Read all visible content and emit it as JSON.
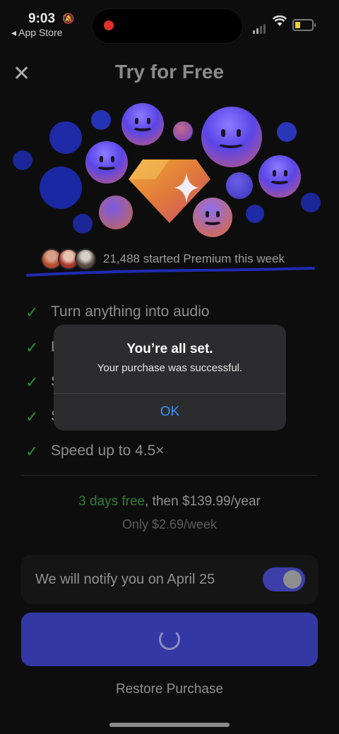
{
  "status_bar": {
    "time": "9:03",
    "back_app": "◂ App Store"
  },
  "header": {
    "close_glyph": "✕",
    "title": "Try for Free"
  },
  "social_proof": {
    "text": "21,488 started Premium this week"
  },
  "features": [
    {
      "check": "✓",
      "label": "Turn anything into audio"
    },
    {
      "check": "✓",
      "label": "L"
    },
    {
      "check": "✓",
      "label": "S"
    },
    {
      "check": "✓",
      "label": "S"
    },
    {
      "check": "✓",
      "label": "Speed up to 4.5×"
    }
  ],
  "pricing": {
    "trial": "3 days free",
    "then": ", then $139.99/year",
    "weekly": "Only $2.69/week"
  },
  "notify": {
    "label": "We will notify you on April 25",
    "enabled": true
  },
  "restore_label": "Restore Purchase",
  "alert": {
    "title": "You’re all set.",
    "message": "Your purchase was successful.",
    "ok_label": "OK"
  },
  "colors": {
    "accent_blue": "#3338a4",
    "alert_ok": "#3a8ff5",
    "trial_green": "#2f7d3a"
  }
}
